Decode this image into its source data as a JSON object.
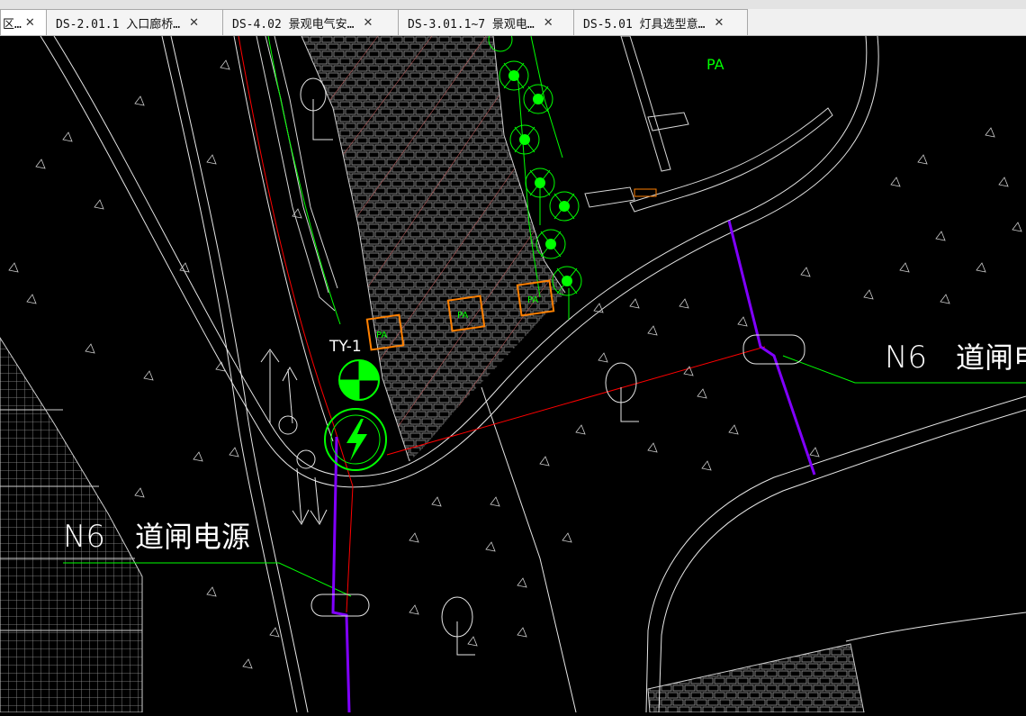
{
  "tabs": [
    {
      "label": "区…",
      "active": true
    },
    {
      "label": "DS-2.01.1 入口廊桥…",
      "active": false
    },
    {
      "label": "DS-4.02 景观电气安…",
      "active": false
    },
    {
      "label": "DS-3.01.1~7 景观电…",
      "active": false
    },
    {
      "label": "DS-5.01 灯具选型意…",
      "active": false
    }
  ],
  "close_glyph": "✕",
  "drawing": {
    "label_pa_top": "PA",
    "label_pa_box1": "PA",
    "label_pa_box2": "PA",
    "label_pa_box3": "PA",
    "label_ty": "TY-1",
    "label_n6_left": "N6",
    "label_gate_left": "道闸电源",
    "label_n6_right": "N6",
    "label_gate_right": "道闸电",
    "colors": {
      "background": "#000000",
      "line": "#ffffff",
      "hatch": "#a9a9a9",
      "green": "#00ff00",
      "red": "#ff0000",
      "orange": "#ff8000",
      "purple": "#8000ff"
    }
  }
}
